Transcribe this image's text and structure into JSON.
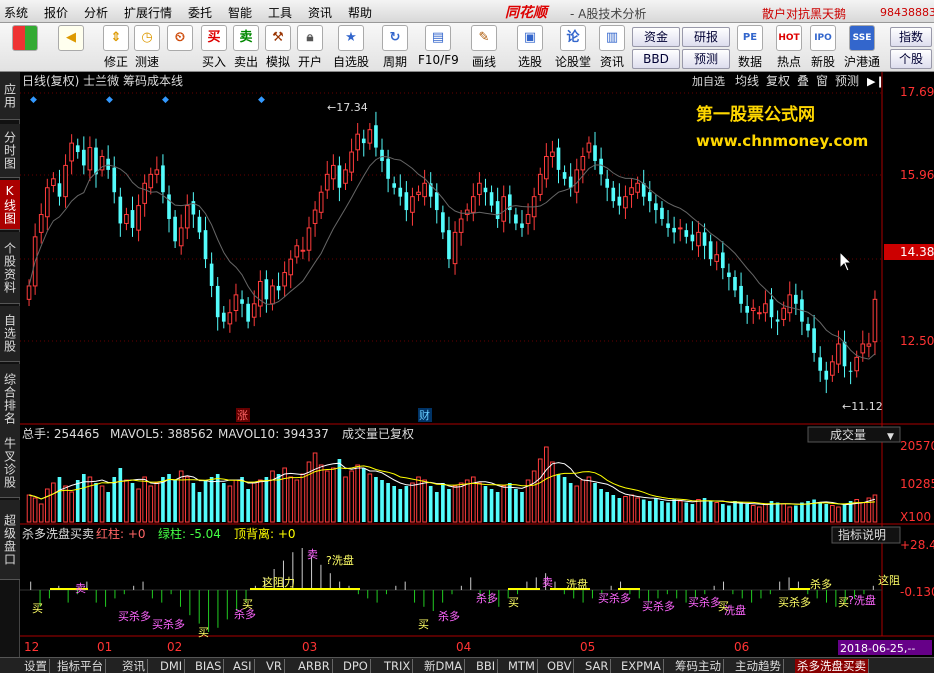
{
  "menubar": {
    "items": [
      "系统",
      "报价",
      "分析",
      "扩展行情",
      "委托",
      "智能",
      "工具",
      "资讯",
      "帮助"
    ],
    "brand": "同花顺",
    "subtitle": "- A股技术分析",
    "promo": "散户对抗黑天鹅",
    "account": "984388831"
  },
  "toolbar": {
    "buttons": [
      {
        "label": "",
        "icon": "layout-icon"
      },
      {
        "label": "",
        "icon": "back-arrow-icon"
      },
      {
        "label": "修正",
        "icon": "up-down-arrows-icon"
      },
      {
        "label": "测速",
        "icon": "clock-icon"
      },
      {
        "label": "买入",
        "icon": "buy-icon",
        "glyph": "买"
      },
      {
        "label": "卖出",
        "icon": "sell-icon",
        "glyph": "卖"
      },
      {
        "label": "模拟",
        "icon": "hammer-icon"
      },
      {
        "label": "开户",
        "icon": "lock-icon"
      },
      {
        "label": "自选股",
        "icon": "star-icon"
      },
      {
        "label": "周期",
        "icon": "cycle-icon"
      },
      {
        "label": "F10/F9",
        "icon": "f10-icon"
      },
      {
        "label": "画线",
        "icon": "pen-icon"
      },
      {
        "label": "选股",
        "icon": "screen-icon"
      },
      {
        "label": "论股堂",
        "icon": "discuss-icon",
        "glyph": "论"
      },
      {
        "label": "资讯",
        "icon": "news-icon"
      },
      {
        "label": "数据",
        "icon": "pe-icon",
        "glyph": "PE"
      },
      {
        "label": "热点",
        "icon": "hot-icon",
        "glyph": "HOT"
      },
      {
        "label": "新股",
        "icon": "ipo-icon",
        "glyph": "IPO"
      },
      {
        "label": "沪港通",
        "icon": "hk-icon",
        "glyph": "SSE"
      }
    ],
    "side_buttons": [
      "资金",
      "BBD",
      "研报",
      "预测",
      "指数",
      "个股"
    ]
  },
  "sidebar": {
    "items": [
      {
        "label": "应用",
        "active": false
      },
      {
        "label": "分时图",
        "active": false
      },
      {
        "label": "K线图",
        "active": true
      },
      {
        "label": "个股资料",
        "active": false
      },
      {
        "label": "自选股",
        "active": false
      },
      {
        "label": "综合排名",
        "active": false
      },
      {
        "label": "牛叉诊股",
        "active": false
      },
      {
        "label": "超级盘口",
        "active": false
      }
    ]
  },
  "kline": {
    "title": "日线(复权) 士兰微 筹码成本线",
    "toolbar": [
      "加自选",
      "均线",
      "复权",
      "叠",
      "窗",
      "预测"
    ],
    "price_labels": [
      "17.69",
      "15.96",
      "14.38",
      "12.50"
    ],
    "current_price": "14.38",
    "high_mark": "17.34",
    "low_mark": "11.12",
    "markers": [
      "涨",
      "财"
    ],
    "watermark_title": "第一股票公式网",
    "watermark_url": "www.chnmoney.com"
  },
  "volume": {
    "total": "总手: 254465",
    "mavol5": "MAVOL5: 388562",
    "mavol10": "MAVOL10: 394337",
    "note": "成交量已复权",
    "dropdown": "成交量",
    "axis": [
      "20570",
      "10285",
      "X100"
    ]
  },
  "indicator": {
    "name": "杀多洗盘买卖",
    "red": "红柱: +0",
    "green": "绿柱: -5.04",
    "top": "顶背离: +0",
    "explain": "指标说明",
    "axis": [
      "+28.42",
      "-0.130"
    ],
    "signals": [
      "买",
      "卖",
      "买杀多",
      "买杀多",
      "买",
      "杀多",
      "买",
      "这阻力",
      "卖",
      "?洗盘",
      "买",
      "杀多",
      "杀多",
      "买",
      "卖",
      "洗盘",
      "买杀多",
      "买杀多",
      "买杀多",
      "买",
      "洗盘",
      "买杀多",
      "杀多",
      "买",
      "?洗盘",
      "这阻"
    ]
  },
  "xaxis": {
    "months": [
      "12",
      "01",
      "02",
      "03",
      "04",
      "05",
      "06"
    ],
    "cursor_date": "2018-06-25,--"
  },
  "bottom_tabs": {
    "items": [
      "设置",
      "指标平台",
      "资讯",
      "DMI",
      "BIAS",
      "ASI",
      "VR",
      "ARBR",
      "DPO",
      "TRIX",
      "新DMA",
      "BBI",
      "MTM",
      "OBV",
      "SAR",
      "EXPMA",
      "筹码主动",
      "主动趋势",
      "杀多洗盘买卖"
    ],
    "active": "杀多洗盘买卖"
  },
  "chart_data": {
    "type": "candlestick",
    "price_range": [
      11.0,
      17.9
    ],
    "colors": {
      "up": "#ff3c3c",
      "down": "#54fcfc",
      "ma": "#ffffff",
      "ma2": "#ffff00",
      "accent": "#ff3c3c"
    },
    "closes": [
      13.6,
      14.7,
      15.2,
      15.8,
      16.0,
      15.6,
      16.3,
      16.8,
      16.6,
      16.3,
      16.7,
      16.1,
      16.5,
      16.2,
      15.7,
      15.0,
      15.2,
      14.9,
      15.4,
      15.9,
      16.1,
      16.2,
      15.7,
      15.1,
      14.6,
      14.9,
      15.4,
      15.2,
      14.8,
      14.2,
      13.6,
      12.9,
      12.8,
      13.0,
      13.4,
      13.2,
      12.8,
      13.2,
      13.7,
      13.3,
      13.6,
      13.5,
      13.9,
      14.2,
      14.5,
      14.4,
      14.9,
      15.3,
      15.7,
      16.1,
      16.3,
      15.8,
      16.2,
      16.6,
      17.0,
      16.8,
      17.1,
      16.7,
      16.4,
      16.0,
      15.8,
      15.6,
      15.3,
      15.6,
      15.7,
      15.9,
      15.6,
      15.3,
      14.8,
      14.2,
      14.8,
      15.1,
      15.3,
      15.6,
      15.9,
      15.7,
      15.4,
      15.1,
      15.6,
      15.3,
      15.0,
      14.9,
      15.2,
      15.6,
      16.1,
      16.5,
      16.6,
      16.2,
      16.0,
      15.8,
      16.2,
      16.5,
      16.8,
      16.4,
      16.1,
      15.8,
      15.5,
      15.4,
      15.6,
      15.8,
      15.9,
      15.6,
      15.5,
      15.3,
      15.1,
      14.9,
      14.8,
      14.9,
      14.7,
      14.6,
      14.8,
      14.5,
      14.2,
      14.3,
      14.0,
      13.8,
      13.5,
      13.2,
      13.0,
      13.1,
      13.0,
      13.2,
      12.9,
      12.8,
      13.1,
      13.4,
      13.2,
      12.8,
      12.6,
      12.1,
      11.7,
      11.5,
      11.9,
      12.3,
      11.8,
      11.7,
      12.0,
      12.3,
      12.3,
      13.3
    ],
    "volumes": [
      180,
      160,
      120,
      220,
      260,
      300,
      240,
      200,
      280,
      320,
      300,
      260,
      240,
      200,
      300,
      360,
      280,
      260,
      220,
      300,
      240,
      260,
      300,
      320,
      280,
      340,
      300,
      260,
      200,
      280,
      300,
      320,
      260,
      240,
      280,
      300,
      220,
      260,
      280,
      300,
      340,
      320,
      360,
      300,
      280,
      320,
      400,
      460,
      380,
      340,
      360,
      420,
      300,
      340,
      380,
      360,
      320,
      300,
      280,
      260,
      240,
      220,
      240,
      260,
      300,
      280,
      240,
      200,
      260,
      220,
      240,
      260,
      280,
      300,
      260,
      240,
      220,
      200,
      240,
      260,
      220,
      200,
      280,
      340,
      420,
      500,
      400,
      320,
      300,
      260,
      240,
      280,
      300,
      260,
      220,
      200,
      180,
      160,
      170,
      180,
      160,
      150,
      140,
      160,
      140,
      130,
      150,
      140,
      130,
      120,
      150,
      160,
      140,
      130,
      120,
      110,
      140,
      130,
      120,
      110,
      100,
      120,
      140,
      130,
      120,
      100,
      110,
      130,
      140,
      150,
      130,
      120,
      110,
      100,
      120,
      140,
      150,
      130,
      160,
      180
    ],
    "indicator_values": [
      20,
      -40,
      -20,
      10,
      -30,
      -10,
      20,
      -30,
      -40,
      -20,
      -10,
      10,
      20,
      -20,
      -30,
      -10,
      -40,
      -60,
      -80,
      -100,
      -90,
      -70,
      -50,
      -30,
      10,
      30,
      50,
      70,
      90,
      100,
      80,
      60,
      40,
      20,
      10,
      -10,
      -20,
      -30,
      -10,
      10,
      20,
      -30,
      -40,
      -50,
      -30,
      -10,
      10,
      30,
      -20,
      -30,
      -40,
      -20,
      -10,
      20,
      30,
      40,
      20,
      -10,
      -20,
      -30,
      -20,
      -10,
      10,
      20,
      -10,
      -20,
      -30,
      -20,
      -10,
      -20,
      -30,
      -20,
      -10,
      10,
      20,
      -10,
      -20,
      -30,
      -20,
      -10,
      20,
      30,
      20,
      -10,
      -20,
      -30,
      -40,
      -30,
      -20,
      -10,
      10
    ]
  }
}
